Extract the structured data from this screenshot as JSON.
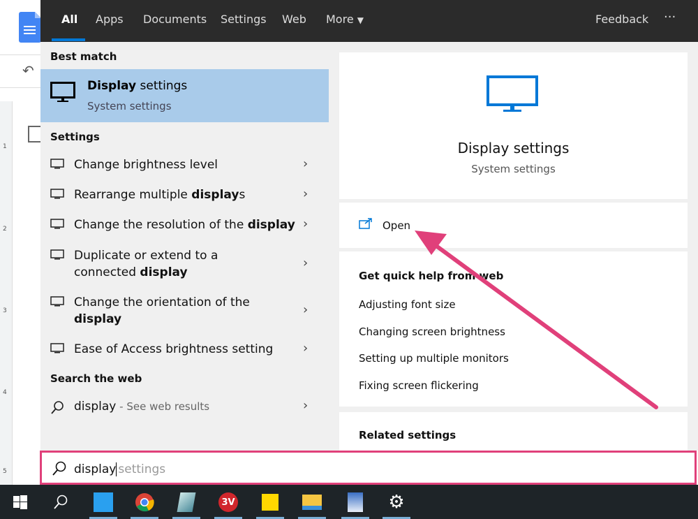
{
  "tabs": [
    {
      "label": "All"
    },
    {
      "label": "Apps"
    },
    {
      "label": "Documents"
    },
    {
      "label": "Settings"
    },
    {
      "label": "Web"
    },
    {
      "label": "More"
    }
  ],
  "feedback": "Feedback",
  "more_options": "···",
  "left": {
    "best_match_heading": "Best match",
    "best_match": {
      "title_bold": "Display",
      "title_rest": " settings",
      "subtitle": "System settings"
    },
    "settings_heading": "Settings",
    "settings_items": [
      {
        "pre": "Change brightness level",
        "bold": "",
        "post": ""
      },
      {
        "pre": "Rearrange multiple ",
        "bold": "display",
        "post": "s"
      },
      {
        "pre": "Change the resolution of the ",
        "bold": "display",
        "post": ""
      },
      {
        "pre": "Duplicate or extend to a connected ",
        "bold": "display",
        "post": ""
      },
      {
        "pre": "Change the orientation of the ",
        "bold": "display",
        "post": ""
      },
      {
        "pre": "Ease of Access brightness setting",
        "bold": "",
        "post": ""
      }
    ],
    "web_heading": "Search the web",
    "web_item": {
      "query": "display",
      "suffix": " - See web results"
    }
  },
  "right": {
    "title": "Display settings",
    "subtitle": "System settings",
    "open": "Open",
    "quick_help_heading": "Get quick help from web",
    "quick_help": [
      "Adjusting font size",
      "Changing screen brightness",
      "Setting up multiple monitors",
      "Fixing screen flickering"
    ],
    "related_heading": "Related settings"
  },
  "search": {
    "typed": "display",
    "suggestion": "settings"
  },
  "ruler_marks": [
    "1",
    "2",
    "3",
    "4",
    "5"
  ],
  "colors": {
    "accent": "#0078d7",
    "highlight": "#a9cbea",
    "annotation": "#e0407a",
    "topbar": "#2b2b2b"
  }
}
